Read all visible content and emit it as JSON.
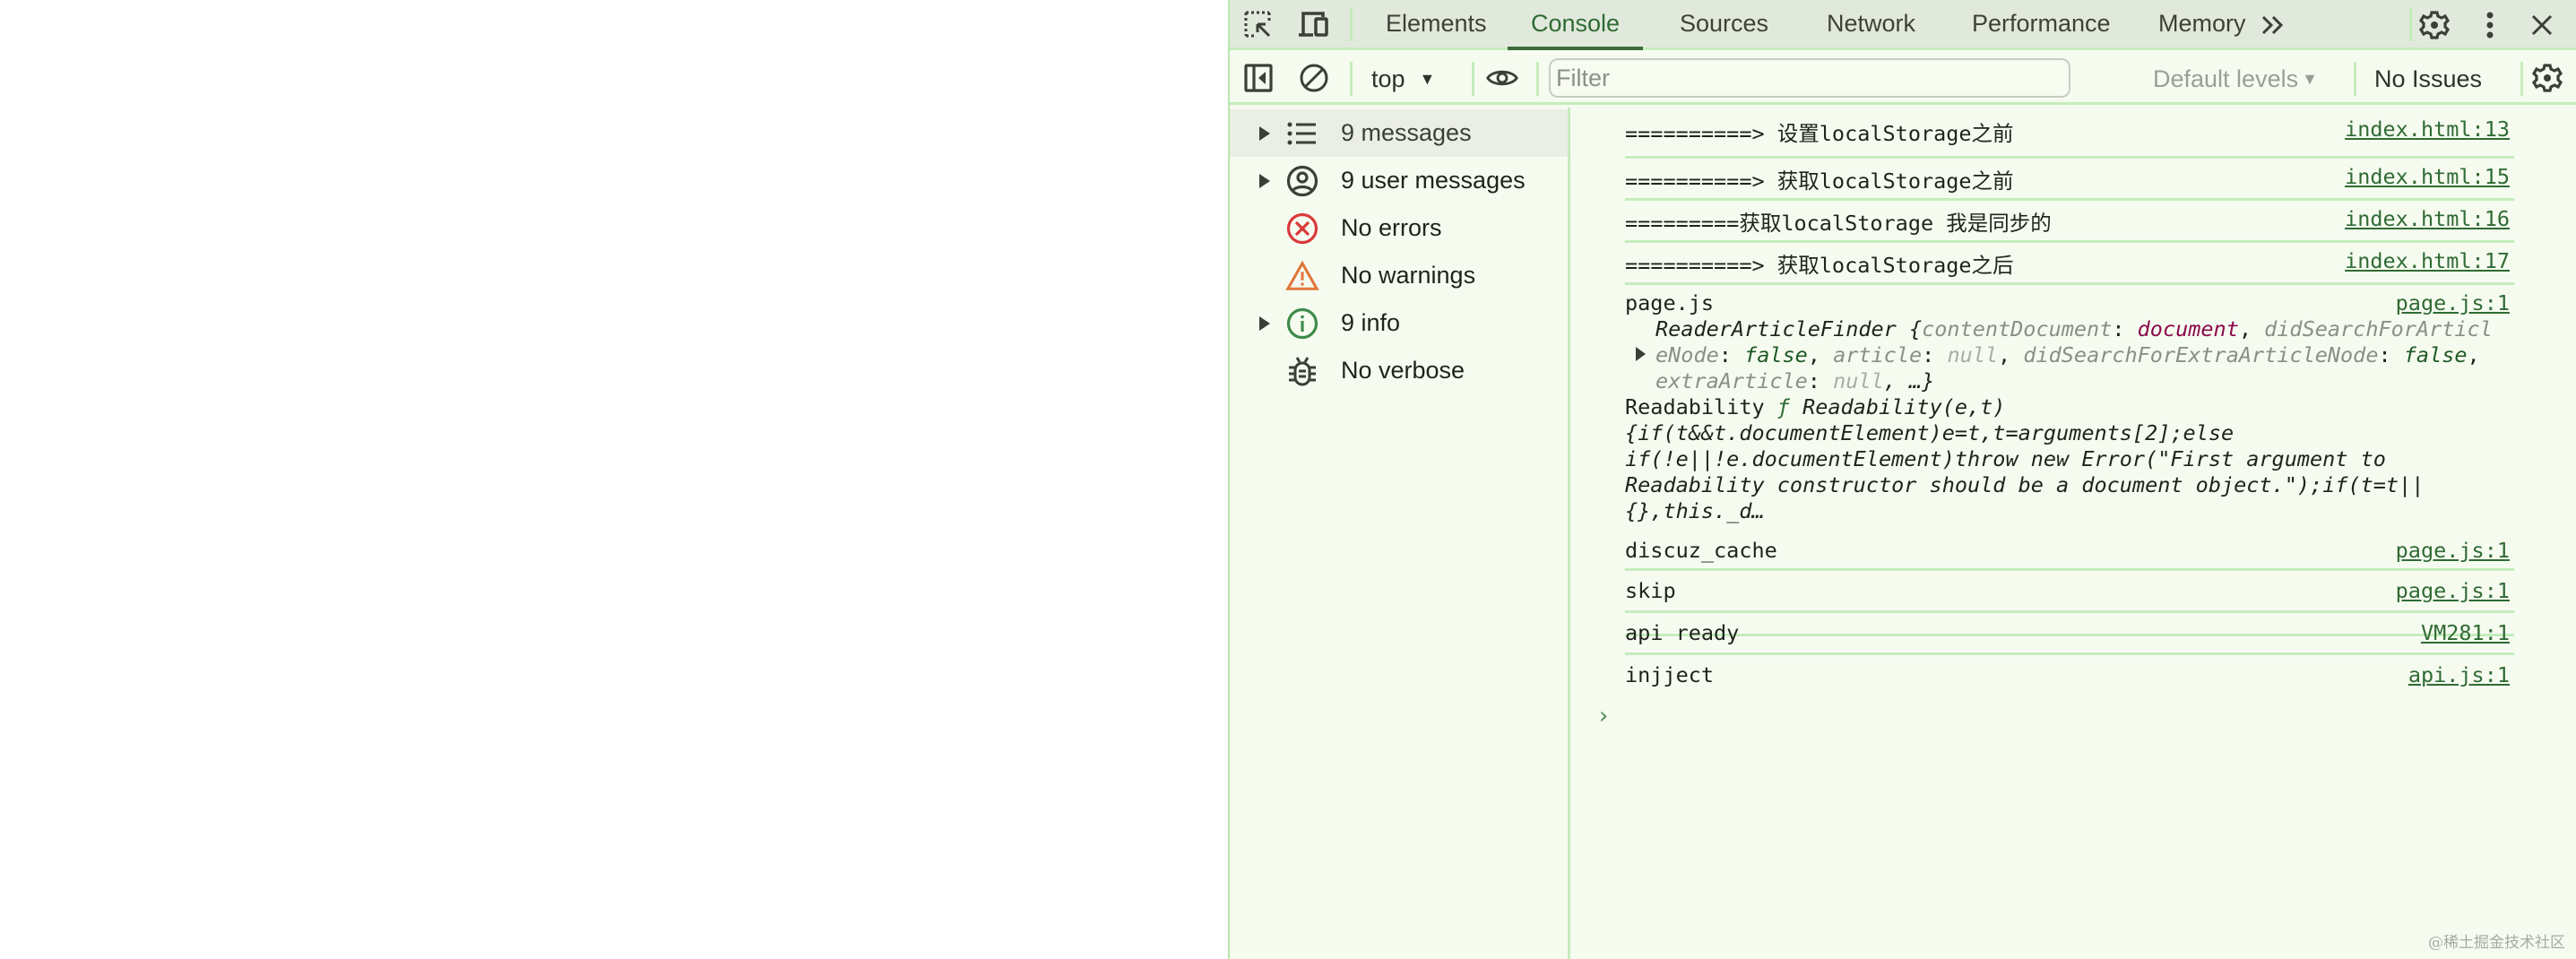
{
  "devtools": {
    "tabs": [
      {
        "label": "Elements",
        "active": false
      },
      {
        "label": "Console",
        "active": true
      },
      {
        "label": "Sources",
        "active": false
      },
      {
        "label": "Network",
        "active": false
      },
      {
        "label": "Performance",
        "active": false
      },
      {
        "label": "Memory",
        "active": false
      }
    ],
    "more_tabs_icon": "double-chevron-right-icon",
    "tabbar_icons": [
      "inspect-element-icon",
      "device-toolbar-icon",
      "gear-icon",
      "kebab-menu-icon",
      "close-icon"
    ],
    "toolbar": {
      "context": "top",
      "filter_placeholder": "Filter",
      "filter_value": "",
      "levels": "Default levels",
      "issues": "No Issues"
    },
    "sidebar": {
      "items": [
        {
          "label": "9 messages",
          "icon": "list-icon",
          "expandable": true,
          "selected": true
        },
        {
          "label": "9 user messages",
          "icon": "user-circle-icon",
          "expandable": true,
          "selected": false
        },
        {
          "label": "No errors",
          "icon": "error-circle-icon",
          "expandable": false,
          "selected": false
        },
        {
          "label": "No warnings",
          "icon": "warning-triangle-icon",
          "expandable": false,
          "selected": false
        },
        {
          "label": "9 info",
          "icon": "info-circle-icon",
          "expandable": true,
          "selected": false
        },
        {
          "label": "No verbose",
          "icon": "bug-icon",
          "expandable": false,
          "selected": false
        }
      ]
    },
    "console": {
      "messages": [
        {
          "text": "==========> 设置localStorage之前",
          "source": "index.html:13"
        },
        {
          "text": "==========> 获取localStorage之前",
          "source": "index.html:15"
        },
        {
          "text": "=========获取localStorage 我是同步的",
          "source": "index.html:16"
        },
        {
          "text": "==========> 获取localStorage之后",
          "source": "index.html:17"
        },
        {
          "text": "page.js",
          "source": "page.js:1",
          "object_line1_prefix": "ReaderArticleFinder {",
          "object_line1_key": "contentDocument",
          "object_line1_val": "document",
          "object_line1_key2": "didSearchForArticl",
          "object_line2_key": "eNode",
          "object_line2_val": "false",
          "object_line2_key2": "article",
          "object_line2_val2": "null",
          "object_line2_key3": "didSearchForExtraArticleNode",
          "object_line2_val3": "false",
          "object_line3_key": "extraArticle",
          "object_line3_val": "null",
          "object_line3_suffix": ", …}",
          "readability_label": "Readability ",
          "readability_f": "ƒ",
          "readability_sig": " Readability(e,t)",
          "readability_code": [
            "{if(t&&t.documentElement)e=t,t=arguments[2];else",
            "if(!e||!e.documentElement)throw new Error(\"First argument to",
            "Readability constructor should be a document object.\");if(t=t||",
            "{},this._d…"
          ]
        },
        {
          "text": "discuz_cache",
          "source": "page.js:1"
        },
        {
          "text": "skip",
          "source": "page.js:1"
        },
        {
          "text": "api ready",
          "source": "VM281:1"
        },
        {
          "text": "injject",
          "source": "api.js:1"
        }
      ],
      "prompt": "›"
    }
  },
  "watermark": "@稀土掘金技术社区"
}
